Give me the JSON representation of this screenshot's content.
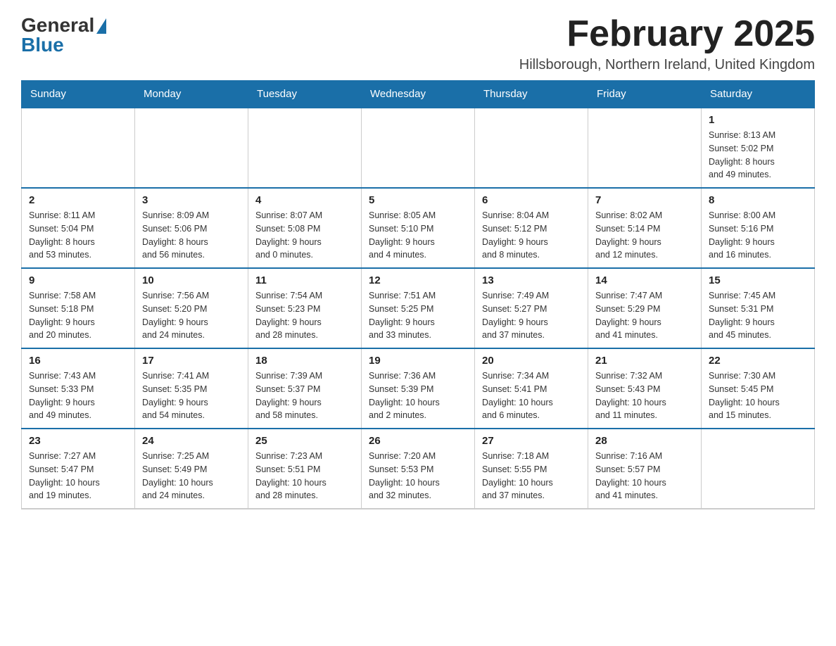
{
  "header": {
    "logo_general": "General",
    "logo_blue": "Blue",
    "month_title": "February 2025",
    "subtitle": "Hillsborough, Northern Ireland, United Kingdom"
  },
  "weekdays": [
    "Sunday",
    "Monday",
    "Tuesday",
    "Wednesday",
    "Thursday",
    "Friday",
    "Saturday"
  ],
  "weeks": [
    [
      {
        "day": "",
        "info": ""
      },
      {
        "day": "",
        "info": ""
      },
      {
        "day": "",
        "info": ""
      },
      {
        "day": "",
        "info": ""
      },
      {
        "day": "",
        "info": ""
      },
      {
        "day": "",
        "info": ""
      },
      {
        "day": "1",
        "info": "Sunrise: 8:13 AM\nSunset: 5:02 PM\nDaylight: 8 hours\nand 49 minutes."
      }
    ],
    [
      {
        "day": "2",
        "info": "Sunrise: 8:11 AM\nSunset: 5:04 PM\nDaylight: 8 hours\nand 53 minutes."
      },
      {
        "day": "3",
        "info": "Sunrise: 8:09 AM\nSunset: 5:06 PM\nDaylight: 8 hours\nand 56 minutes."
      },
      {
        "day": "4",
        "info": "Sunrise: 8:07 AM\nSunset: 5:08 PM\nDaylight: 9 hours\nand 0 minutes."
      },
      {
        "day": "5",
        "info": "Sunrise: 8:05 AM\nSunset: 5:10 PM\nDaylight: 9 hours\nand 4 minutes."
      },
      {
        "day": "6",
        "info": "Sunrise: 8:04 AM\nSunset: 5:12 PM\nDaylight: 9 hours\nand 8 minutes."
      },
      {
        "day": "7",
        "info": "Sunrise: 8:02 AM\nSunset: 5:14 PM\nDaylight: 9 hours\nand 12 minutes."
      },
      {
        "day": "8",
        "info": "Sunrise: 8:00 AM\nSunset: 5:16 PM\nDaylight: 9 hours\nand 16 minutes."
      }
    ],
    [
      {
        "day": "9",
        "info": "Sunrise: 7:58 AM\nSunset: 5:18 PM\nDaylight: 9 hours\nand 20 minutes."
      },
      {
        "day": "10",
        "info": "Sunrise: 7:56 AM\nSunset: 5:20 PM\nDaylight: 9 hours\nand 24 minutes."
      },
      {
        "day": "11",
        "info": "Sunrise: 7:54 AM\nSunset: 5:23 PM\nDaylight: 9 hours\nand 28 minutes."
      },
      {
        "day": "12",
        "info": "Sunrise: 7:51 AM\nSunset: 5:25 PM\nDaylight: 9 hours\nand 33 minutes."
      },
      {
        "day": "13",
        "info": "Sunrise: 7:49 AM\nSunset: 5:27 PM\nDaylight: 9 hours\nand 37 minutes."
      },
      {
        "day": "14",
        "info": "Sunrise: 7:47 AM\nSunset: 5:29 PM\nDaylight: 9 hours\nand 41 minutes."
      },
      {
        "day": "15",
        "info": "Sunrise: 7:45 AM\nSunset: 5:31 PM\nDaylight: 9 hours\nand 45 minutes."
      }
    ],
    [
      {
        "day": "16",
        "info": "Sunrise: 7:43 AM\nSunset: 5:33 PM\nDaylight: 9 hours\nand 49 minutes."
      },
      {
        "day": "17",
        "info": "Sunrise: 7:41 AM\nSunset: 5:35 PM\nDaylight: 9 hours\nand 54 minutes."
      },
      {
        "day": "18",
        "info": "Sunrise: 7:39 AM\nSunset: 5:37 PM\nDaylight: 9 hours\nand 58 minutes."
      },
      {
        "day": "19",
        "info": "Sunrise: 7:36 AM\nSunset: 5:39 PM\nDaylight: 10 hours\nand 2 minutes."
      },
      {
        "day": "20",
        "info": "Sunrise: 7:34 AM\nSunset: 5:41 PM\nDaylight: 10 hours\nand 6 minutes."
      },
      {
        "day": "21",
        "info": "Sunrise: 7:32 AM\nSunset: 5:43 PM\nDaylight: 10 hours\nand 11 minutes."
      },
      {
        "day": "22",
        "info": "Sunrise: 7:30 AM\nSunset: 5:45 PM\nDaylight: 10 hours\nand 15 minutes."
      }
    ],
    [
      {
        "day": "23",
        "info": "Sunrise: 7:27 AM\nSunset: 5:47 PM\nDaylight: 10 hours\nand 19 minutes."
      },
      {
        "day": "24",
        "info": "Sunrise: 7:25 AM\nSunset: 5:49 PM\nDaylight: 10 hours\nand 24 minutes."
      },
      {
        "day": "25",
        "info": "Sunrise: 7:23 AM\nSunset: 5:51 PM\nDaylight: 10 hours\nand 28 minutes."
      },
      {
        "day": "26",
        "info": "Sunrise: 7:20 AM\nSunset: 5:53 PM\nDaylight: 10 hours\nand 32 minutes."
      },
      {
        "day": "27",
        "info": "Sunrise: 7:18 AM\nSunset: 5:55 PM\nDaylight: 10 hours\nand 37 minutes."
      },
      {
        "day": "28",
        "info": "Sunrise: 7:16 AM\nSunset: 5:57 PM\nDaylight: 10 hours\nand 41 minutes."
      },
      {
        "day": "",
        "info": ""
      }
    ]
  ]
}
